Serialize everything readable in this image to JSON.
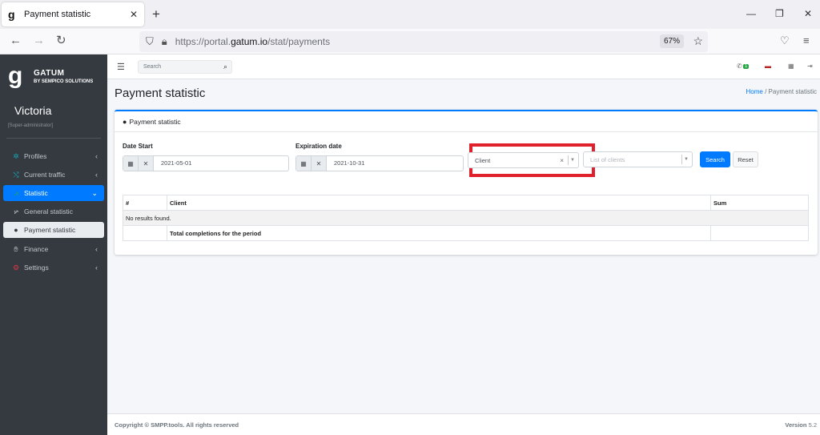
{
  "browser": {
    "tab_title": "Payment statistic",
    "url_prefix": "https://portal.",
    "url_domain": "gatum.io",
    "url_path": "/stat/payments",
    "zoom": "67%"
  },
  "sidebar": {
    "brand_name": "GATUM",
    "brand_sub": "BY SEMPICO SOLUTIONS",
    "user_name": "Victoria",
    "user_role": "[Super-administrator]",
    "items": [
      {
        "label": "Profiles",
        "icon": "network-icon"
      },
      {
        "label": "Current traffic",
        "icon": "traffic-icon"
      },
      {
        "label": "Statistic",
        "icon": "chart-icon"
      },
      {
        "label": "General statistic",
        "icon": "area-chart-icon"
      },
      {
        "label": "Payment statistic",
        "icon": "money-bag-icon"
      },
      {
        "label": "Finance",
        "icon": "hand-coin-icon"
      },
      {
        "label": "Settings",
        "icon": "gears-icon"
      }
    ]
  },
  "topnav": {
    "search_placeholder": "Search",
    "notification_count": "1"
  },
  "page": {
    "title": "Payment statistic",
    "breadcrumb_home": "Home",
    "breadcrumb_sep": "/",
    "breadcrumb_current": "Payment statistic"
  },
  "card": {
    "header": "Payment statistic",
    "date_start_label": "Date Start",
    "date_start_value": "2021-05-01",
    "expiration_label": "Expiration date",
    "expiration_value": "2021-10-31",
    "client_select_value": "Client",
    "clients_placeholder": "List of clients",
    "search_btn": "Search",
    "reset_btn": "Reset"
  },
  "table": {
    "headers": [
      "#",
      "Client",
      "Sum"
    ],
    "empty_message": "No results found.",
    "total_label": "Total completions for the period"
  },
  "footer": {
    "copyright": "Copyright © SMPP.tools. All rights reserved",
    "version_label": "Version",
    "version_value": "5.2"
  },
  "colors": {
    "accent": "#007bff",
    "sidebar_bg": "#343a40",
    "highlight": "#e0202a"
  }
}
